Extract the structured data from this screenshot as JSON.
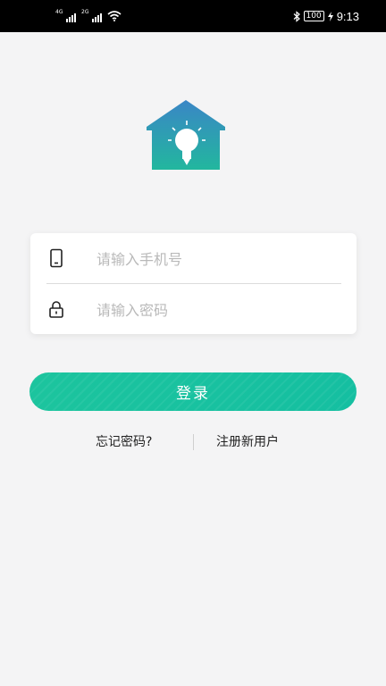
{
  "status_bar": {
    "signal_1_label": "4G",
    "signal_2_label": "2G",
    "battery": "100",
    "time": "9:13"
  },
  "login": {
    "phone_placeholder": "请输入手机号",
    "password_placeholder": "请输入密码",
    "login_button": "登录",
    "forgot_password": "忘记密码?",
    "register": "注册新用户"
  },
  "colors": {
    "accent": "#1bc3a0",
    "logo_top": "#3a86c6",
    "logo_bottom": "#22b79e"
  },
  "icons": {
    "logo": "house-lightbulb-icon",
    "phone": "smartphone-icon",
    "password": "lock-icon"
  }
}
